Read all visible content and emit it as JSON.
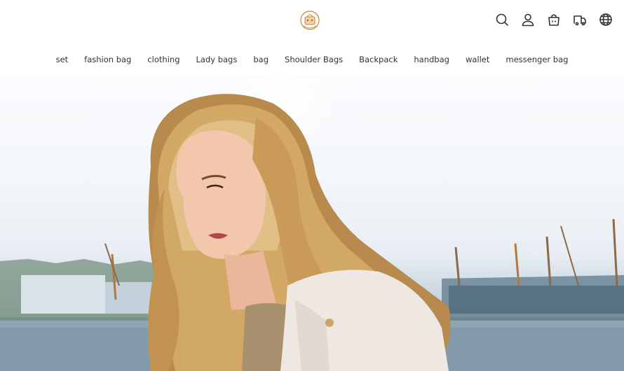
{
  "header": {
    "logo": "bag-shop-logo",
    "icons": [
      "search-icon",
      "user-icon",
      "cart-icon",
      "shipping-truck-icon",
      "globe-icon"
    ]
  },
  "nav": {
    "items": [
      "set",
      "fashion bag",
      "clothing",
      "Lady bags",
      "bag",
      "Shoulder Bags",
      "Backpack",
      "handbag",
      "wallet",
      "messenger bag"
    ]
  },
  "hero": {
    "image": "woman-with-long-blonde-hair-in-white-coat-by-harbor"
  },
  "colors": {
    "text": "#333333",
    "background": "#ffffff",
    "logo_accent": "#c8833a"
  }
}
